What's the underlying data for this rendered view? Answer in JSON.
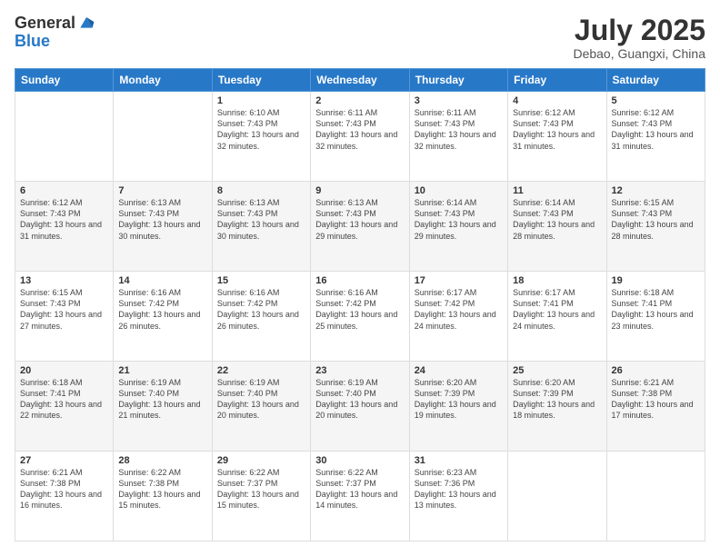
{
  "header": {
    "logo_line1": "General",
    "logo_line2": "Blue",
    "month_year": "July 2025",
    "location": "Debao, Guangxi, China"
  },
  "weekdays": [
    "Sunday",
    "Monday",
    "Tuesday",
    "Wednesday",
    "Thursday",
    "Friday",
    "Saturday"
  ],
  "weeks": [
    [
      {
        "day": "",
        "info": ""
      },
      {
        "day": "",
        "info": ""
      },
      {
        "day": "1",
        "info": "Sunrise: 6:10 AM\nSunset: 7:43 PM\nDaylight: 13 hours and 32 minutes."
      },
      {
        "day": "2",
        "info": "Sunrise: 6:11 AM\nSunset: 7:43 PM\nDaylight: 13 hours and 32 minutes."
      },
      {
        "day": "3",
        "info": "Sunrise: 6:11 AM\nSunset: 7:43 PM\nDaylight: 13 hours and 32 minutes."
      },
      {
        "day": "4",
        "info": "Sunrise: 6:12 AM\nSunset: 7:43 PM\nDaylight: 13 hours and 31 minutes."
      },
      {
        "day": "5",
        "info": "Sunrise: 6:12 AM\nSunset: 7:43 PM\nDaylight: 13 hours and 31 minutes."
      }
    ],
    [
      {
        "day": "6",
        "info": "Sunrise: 6:12 AM\nSunset: 7:43 PM\nDaylight: 13 hours and 31 minutes."
      },
      {
        "day": "7",
        "info": "Sunrise: 6:13 AM\nSunset: 7:43 PM\nDaylight: 13 hours and 30 minutes."
      },
      {
        "day": "8",
        "info": "Sunrise: 6:13 AM\nSunset: 7:43 PM\nDaylight: 13 hours and 30 minutes."
      },
      {
        "day": "9",
        "info": "Sunrise: 6:13 AM\nSunset: 7:43 PM\nDaylight: 13 hours and 29 minutes."
      },
      {
        "day": "10",
        "info": "Sunrise: 6:14 AM\nSunset: 7:43 PM\nDaylight: 13 hours and 29 minutes."
      },
      {
        "day": "11",
        "info": "Sunrise: 6:14 AM\nSunset: 7:43 PM\nDaylight: 13 hours and 28 minutes."
      },
      {
        "day": "12",
        "info": "Sunrise: 6:15 AM\nSunset: 7:43 PM\nDaylight: 13 hours and 28 minutes."
      }
    ],
    [
      {
        "day": "13",
        "info": "Sunrise: 6:15 AM\nSunset: 7:43 PM\nDaylight: 13 hours and 27 minutes."
      },
      {
        "day": "14",
        "info": "Sunrise: 6:16 AM\nSunset: 7:42 PM\nDaylight: 13 hours and 26 minutes."
      },
      {
        "day": "15",
        "info": "Sunrise: 6:16 AM\nSunset: 7:42 PM\nDaylight: 13 hours and 26 minutes."
      },
      {
        "day": "16",
        "info": "Sunrise: 6:16 AM\nSunset: 7:42 PM\nDaylight: 13 hours and 25 minutes."
      },
      {
        "day": "17",
        "info": "Sunrise: 6:17 AM\nSunset: 7:42 PM\nDaylight: 13 hours and 24 minutes."
      },
      {
        "day": "18",
        "info": "Sunrise: 6:17 AM\nSunset: 7:41 PM\nDaylight: 13 hours and 24 minutes."
      },
      {
        "day": "19",
        "info": "Sunrise: 6:18 AM\nSunset: 7:41 PM\nDaylight: 13 hours and 23 minutes."
      }
    ],
    [
      {
        "day": "20",
        "info": "Sunrise: 6:18 AM\nSunset: 7:41 PM\nDaylight: 13 hours and 22 minutes."
      },
      {
        "day": "21",
        "info": "Sunrise: 6:19 AM\nSunset: 7:40 PM\nDaylight: 13 hours and 21 minutes."
      },
      {
        "day": "22",
        "info": "Sunrise: 6:19 AM\nSunset: 7:40 PM\nDaylight: 13 hours and 20 minutes."
      },
      {
        "day": "23",
        "info": "Sunrise: 6:19 AM\nSunset: 7:40 PM\nDaylight: 13 hours and 20 minutes."
      },
      {
        "day": "24",
        "info": "Sunrise: 6:20 AM\nSunset: 7:39 PM\nDaylight: 13 hours and 19 minutes."
      },
      {
        "day": "25",
        "info": "Sunrise: 6:20 AM\nSunset: 7:39 PM\nDaylight: 13 hours and 18 minutes."
      },
      {
        "day": "26",
        "info": "Sunrise: 6:21 AM\nSunset: 7:38 PM\nDaylight: 13 hours and 17 minutes."
      }
    ],
    [
      {
        "day": "27",
        "info": "Sunrise: 6:21 AM\nSunset: 7:38 PM\nDaylight: 13 hours and 16 minutes."
      },
      {
        "day": "28",
        "info": "Sunrise: 6:22 AM\nSunset: 7:38 PM\nDaylight: 13 hours and 15 minutes."
      },
      {
        "day": "29",
        "info": "Sunrise: 6:22 AM\nSunset: 7:37 PM\nDaylight: 13 hours and 15 minutes."
      },
      {
        "day": "30",
        "info": "Sunrise: 6:22 AM\nSunset: 7:37 PM\nDaylight: 13 hours and 14 minutes."
      },
      {
        "day": "31",
        "info": "Sunrise: 6:23 AM\nSunset: 7:36 PM\nDaylight: 13 hours and 13 minutes."
      },
      {
        "day": "",
        "info": ""
      },
      {
        "day": "",
        "info": ""
      }
    ]
  ]
}
